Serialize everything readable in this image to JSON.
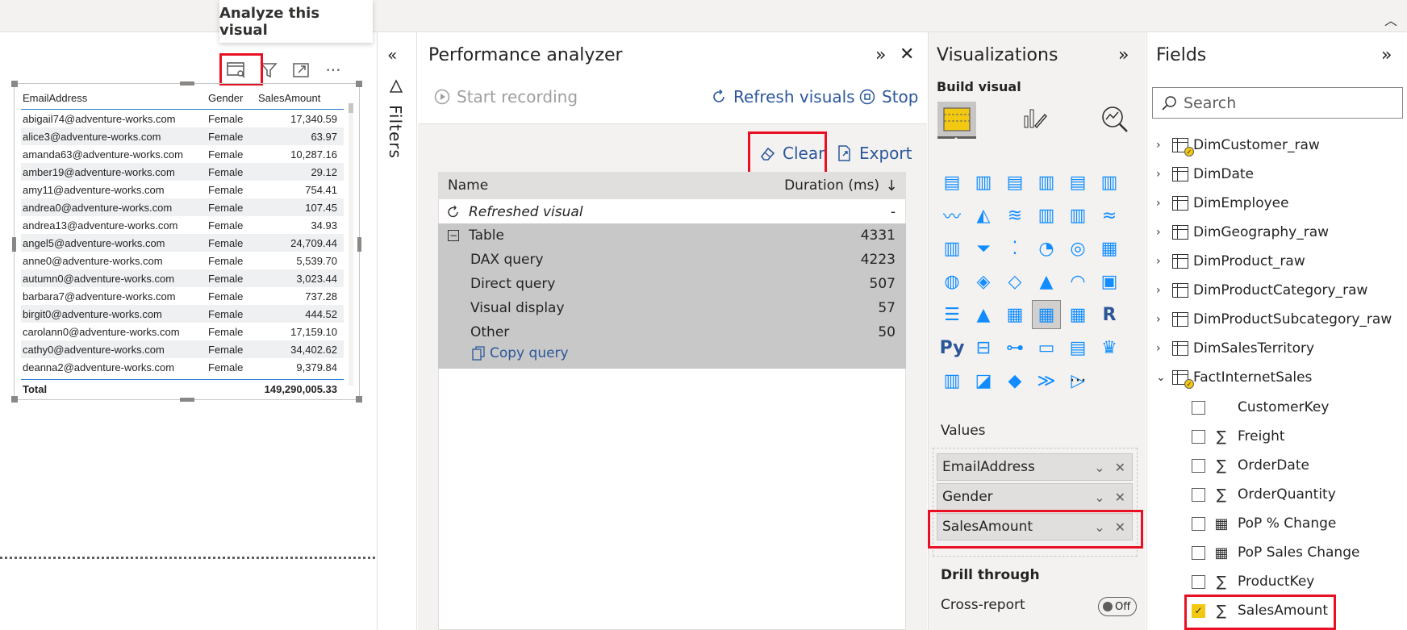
{
  "tooltip": "Analyze this visual",
  "table": {
    "headers": [
      "EmailAddress",
      "Gender",
      "SalesAmount"
    ],
    "rows": [
      [
        "abigail74@adventure-works.com",
        "Female",
        "17,340.59"
      ],
      [
        "alice3@adventure-works.com",
        "Female",
        "63.97"
      ],
      [
        "amanda63@adventure-works.com",
        "Female",
        "10,287.16"
      ],
      [
        "amber19@adventure-works.com",
        "Female",
        "29.12"
      ],
      [
        "amy11@adventure-works.com",
        "Female",
        "754.41"
      ],
      [
        "andrea0@adventure-works.com",
        "Female",
        "107.45"
      ],
      [
        "andrea13@adventure-works.com",
        "Female",
        "34.93"
      ],
      [
        "angel5@adventure-works.com",
        "Female",
        "24,709.44"
      ],
      [
        "anne0@adventure-works.com",
        "Female",
        "5,539.70"
      ],
      [
        "autumn0@adventure-works.com",
        "Female",
        "3,023.44"
      ],
      [
        "barbara7@adventure-works.com",
        "Female",
        "737.28"
      ],
      [
        "birgit0@adventure-works.com",
        "Female",
        "444.52"
      ],
      [
        "carolann0@adventure-works.com",
        "Female",
        "17,159.10"
      ],
      [
        "cathy0@adventure-works.com",
        "Female",
        "34,402.62"
      ],
      [
        "deanna2@adventure-works.com",
        "Female",
        "9,379.84"
      ]
    ],
    "total_label": "Total",
    "total_value": "149,290,005.33"
  },
  "filters_label": "Filters",
  "perf": {
    "title": "Performance analyzer",
    "start_recording": "Start recording",
    "refresh_visuals": "Refresh visuals",
    "stop": "Stop",
    "clear": "Clear",
    "export": "Export",
    "col_name": "Name",
    "col_duration": "Duration (ms)",
    "refreshed_visual": "Refreshed visual",
    "refreshed_dur": "-",
    "table_label": "Table",
    "table_dur": "4331",
    "items": [
      {
        "name": "DAX query",
        "dur": "4223"
      },
      {
        "name": "Direct query",
        "dur": "507"
      },
      {
        "name": "Visual display",
        "dur": "57"
      },
      {
        "name": "Other",
        "dur": "50"
      }
    ],
    "copy_query": "Copy query"
  },
  "viz": {
    "title": "Visualizations",
    "build_visual": "Build visual",
    "values_label": "Values",
    "wells": [
      "EmailAddress",
      "Gender",
      "SalesAmount"
    ],
    "drill_through": "Drill through",
    "cross_report": "Cross-report",
    "toggle": "Off",
    "more": "···"
  },
  "fields": {
    "title": "Fields",
    "search_placeholder": "Search",
    "tables": [
      "DimCustomer_raw",
      "DimDate",
      "DimEmployee",
      "DimGeography_raw",
      "DimProduct_raw",
      "DimProductCategory_raw",
      "DimProductSubcategory_raw",
      "DimSalesTerritory",
      "FactInternetSales"
    ],
    "columns": [
      {
        "name": "CustomerKey",
        "type": "",
        "checked": false
      },
      {
        "name": "Freight",
        "type": "∑",
        "checked": false
      },
      {
        "name": "OrderDate",
        "type": "∑",
        "checked": false
      },
      {
        "name": "OrderQuantity",
        "type": "∑",
        "checked": false
      },
      {
        "name": "PoP % Change",
        "type": "▦",
        "checked": false
      },
      {
        "name": "PoP Sales Change",
        "type": "▦",
        "checked": false
      },
      {
        "name": "ProductKey",
        "type": "∑",
        "checked": false
      },
      {
        "name": "SalesAmount",
        "type": "∑",
        "checked": true
      }
    ]
  }
}
